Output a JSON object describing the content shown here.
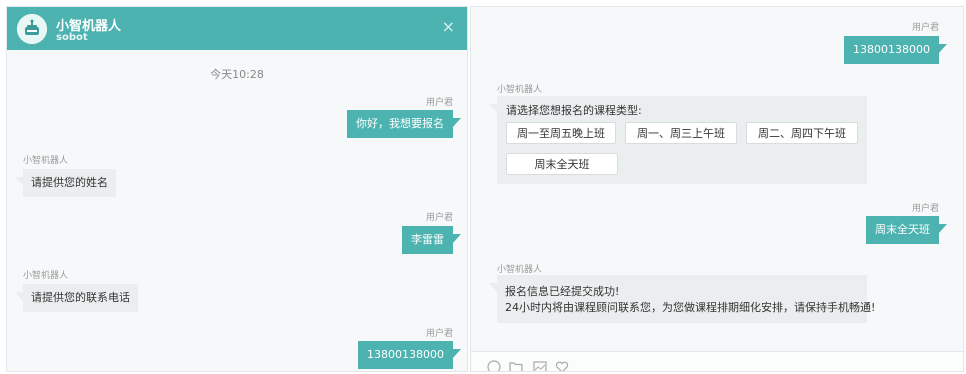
{
  "left": {
    "bot_name": "小智机器人",
    "bot_sub": "sobot",
    "close": "×",
    "timestamp": "今天10:28",
    "messages": [
      {
        "sender": "用户君",
        "text": "你好，我想要报名"
      },
      {
        "sender": "小智机器人",
        "text": "请提供您的姓名"
      },
      {
        "sender": "用户君",
        "text": "李雷雷"
      },
      {
        "sender": "小智机器人",
        "text": "请提供您的联系电话"
      },
      {
        "sender": "用户君",
        "text": "13800138000"
      }
    ]
  },
  "right": {
    "messages": [
      {
        "sender": "用户君",
        "text": "13800138000"
      },
      {
        "sender": "小智机器人",
        "text": "请选择您想报名的课程类型:"
      },
      {
        "sender": "用户君",
        "text": "周末全天班"
      },
      {
        "sender": "小智机器人",
        "line1": "报名信息已经提交成功!",
        "line2": "24小时内将由课程顾问联系您，为您做课程排期细化安排，请保持手机畅通!"
      }
    ],
    "options": [
      "周一至周五晚上班",
      "周一、周三上午班",
      "周二、周四下午班",
      "周末全天班"
    ]
  },
  "colors": {
    "accent": "#4db3b0",
    "bot_bubble": "#ebeeef",
    "panel_bg": "#f6f8f9"
  },
  "icons": [
    "robot-avatar-icon",
    "emoji-icon",
    "folder-icon",
    "image-icon",
    "heart-icon"
  ]
}
